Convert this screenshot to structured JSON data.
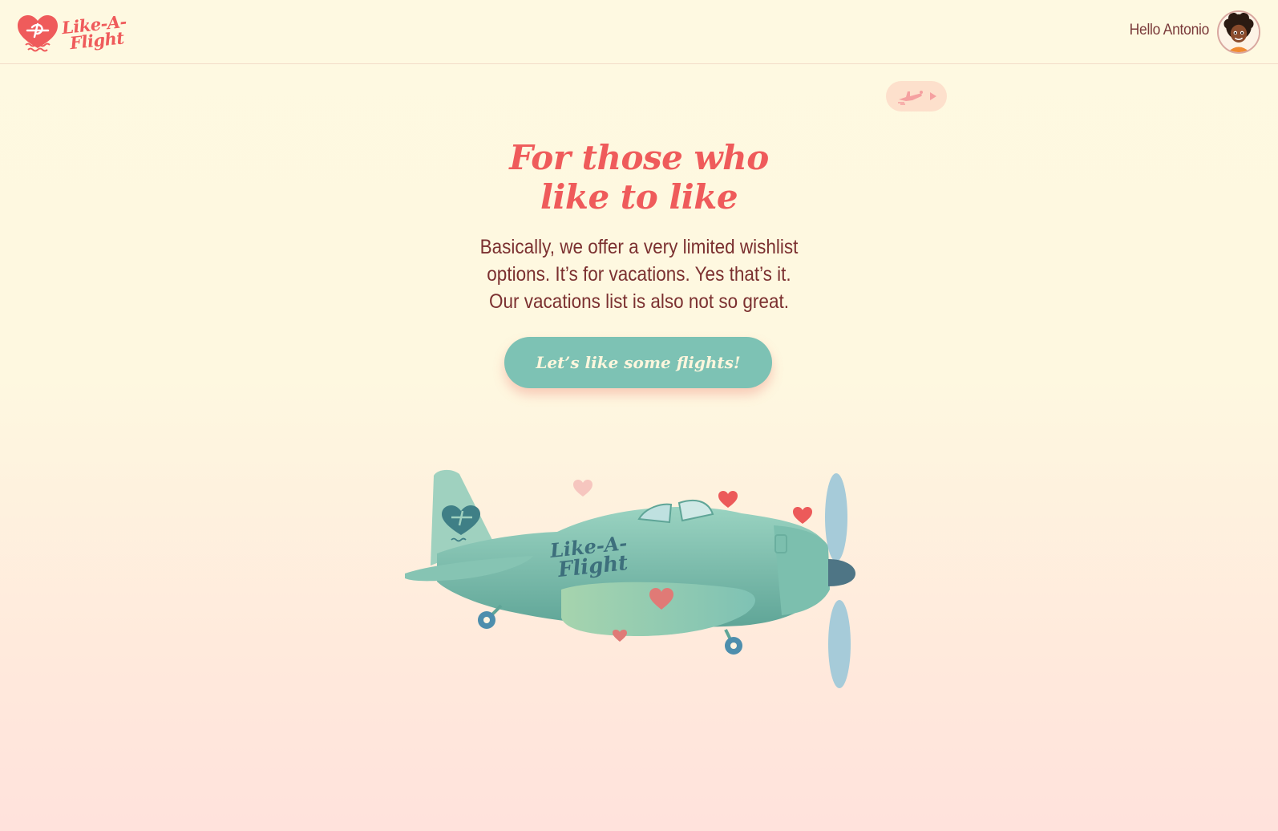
{
  "header": {
    "logo_line1": "Like-A-",
    "logo_line2": "Flight",
    "greeting": "Hello Antonio",
    "avatar_icon": "avatar"
  },
  "music_toggle": {
    "icon": "airplane-icon",
    "play_icon": "play-icon"
  },
  "hero": {
    "title_line1": "For those who",
    "title_line2": "like to like",
    "description_line1": "Basically, we offer a very limited wishlist",
    "description_line2": "options. It’s for vacations. Yes that’s it.",
    "description_line3": "Our vacations list is also not so great.",
    "cta_label": "Let’s like some flights!"
  },
  "illustration": {
    "name": "airplane-illustration",
    "text_line1": "Like-A-",
    "text_line2": "Flight"
  },
  "colors": {
    "brand_coral": "#ef5b5b",
    "text_maroon": "#7b3030",
    "cta_teal": "#7dc2b4",
    "background": "#fef9e1"
  }
}
